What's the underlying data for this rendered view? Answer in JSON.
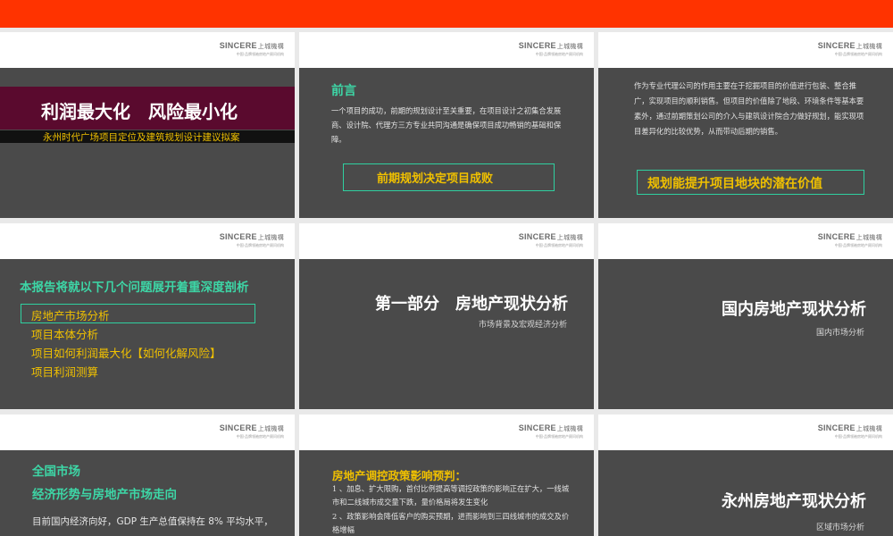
{
  "logo": {
    "brand": "SINCERE",
    "cn": "上城機構",
    "tagline": "中国·品牌领袖房地产顾问机构"
  },
  "slides": {
    "s1": {
      "title": "利润最大化　风险最小化",
      "subtitle": "永州时代广场项目定位及建筑规划设计建议拟案"
    },
    "s2": {
      "heading": "前言",
      "paragraph": "一个项目的成功，前期的规划设计至关重要，在项目设计之初集合发展商、设计院、代理方三方专业共同沟通是确保项目成功畅销的基础和保障。",
      "boxed": "前期规划决定项目成败"
    },
    "s3": {
      "paragraph": "作为专业代理公司的作用主要在于挖掘项目的价值进行包装、整合推广，实现项目的顺利销售。但项目的价值除了地段、环境条件等基本要素外，通过前期策划公司的介入与建筑设计院合力做好规划，能实现项目差异化的比较优势，从而带动后期的销售。",
      "boxed": "规划能提升项目地块的潜在价值"
    },
    "s4": {
      "heading": "本报告将就以下几个问题展开着重深度剖析",
      "items": [
        "房地产市场分析",
        "项目本体分析",
        "项目如何利润最大化【如何化解风险】",
        "项目利润测算"
      ]
    },
    "s5": {
      "title": "第一部分　房地产现状分析",
      "subtitle": "市场背景及宏观经济分析"
    },
    "s6": {
      "title": "国内房地产现状分析",
      "subtitle": "国内市场分析"
    },
    "s7": {
      "heading1": "全国市场",
      "heading2": "经济形势与房地产市场走向",
      "paragraph": "目前国内经济向好，GDP 生产总值保持在 8% 平均水平，"
    },
    "s8": {
      "heading": "房地产调控政策影响预判：",
      "line1": "1 、加息、扩大限购，首付比例提高等调控政策的影响正在扩大，一线城市和二线城市成交量下跌，量价格局将发生变化",
      "line2": "2 、政策影响会降低客户的购买预期，进而影响到三四线城市的成交及价格增幅"
    },
    "s9": {
      "title": "永州房地产现状分析",
      "subtitle": "区域市场分析"
    }
  },
  "colors": {
    "topbar": "#ff3300",
    "slide_bg": "#4a4a4a",
    "teal": "#3dd6a6",
    "gold": "#f0c000",
    "hero_band": "#5a0a2e"
  }
}
